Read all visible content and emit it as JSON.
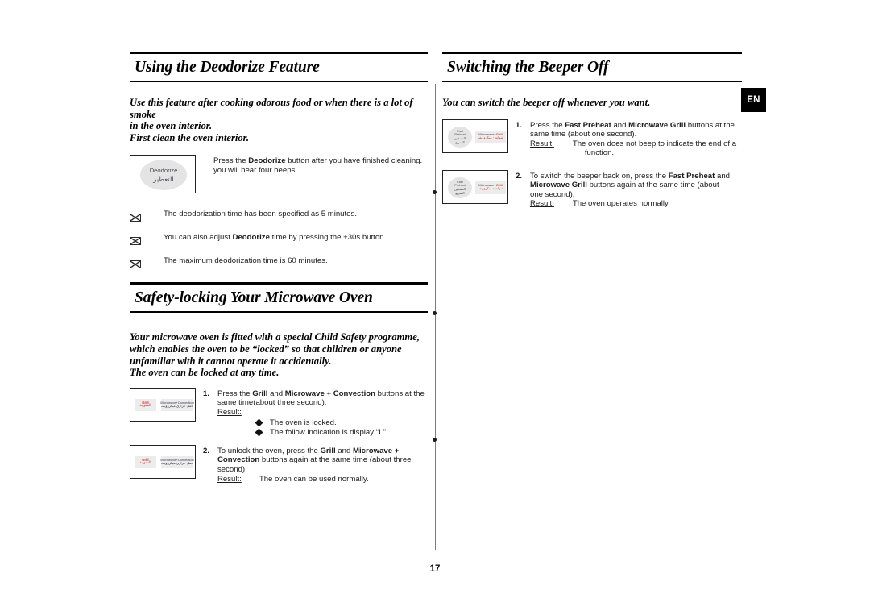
{
  "page": {
    "number": "17",
    "language_badge": "EN"
  },
  "left_column": {
    "section1": {
      "heading": "Using the Deodorize Feature",
      "intro_line1": "Use this feature after cooking odorous food or when there is a lot of smoke",
      "intro_line2": "in the oven interior.",
      "intro_line3": "First clean the oven interior.",
      "button_image": {
        "label_en": "Deodorize",
        "label_ar": "التعطير"
      },
      "instruction_line1_a": "Press the ",
      "instruction_line1_b": "Deodorize",
      "instruction_line1_c": " button after you have finished cleaning.",
      "instruction_line2": "you will hear four beeps.",
      "notes": [
        {
          "icon": "note-marker-icon",
          "text_a": "The deodorization time has been specified as 5 minutes.",
          "bold": "",
          "text_b": ""
        },
        {
          "icon": "note-marker-icon",
          "text_a": "You can also adjust ",
          "bold": "Deodorize",
          "text_b": " time by pressing the +30s button."
        },
        {
          "icon": "note-marker-icon",
          "text_a": "The maximum deodorization time is 60 minutes.",
          "bold": "",
          "text_b": ""
        }
      ]
    },
    "section2": {
      "heading": "Safety-locking Your Microwave Oven",
      "intro_line1": "Your microwave oven is fitted with a special Child Safety programme,",
      "intro_line2": "which enables the oven to be “locked” so that children or anyone",
      "intro_line3": "unfamiliar with it cannot operate it accidentally.",
      "intro_line4": "The oven can be locked at any time.",
      "button_image": {
        "chip1_en": "Grill",
        "chip1_ar": "الشواية",
        "chip2_en": "Microwave+Convection",
        "chip2_ar": "حمل حراري ميكروويف"
      },
      "steps": [
        {
          "number": "1.",
          "line1_a": "Press the ",
          "line1_bold1": "Grill",
          "line1_b": " and ",
          "line1_bold2": "Microwave + Convection",
          "line1_c": " buttons at the",
          "line2": "same time(about three second).",
          "result_label": "Result:",
          "result_inline": "",
          "bullets": [
            {
              "text_a": "The oven is locked.",
              "bold": "",
              "text_b": ""
            },
            {
              "text_a": "The follow indication is display “",
              "bold": "L",
              "text_b": "”."
            }
          ]
        },
        {
          "number": "2.",
          "line1_a": "To unlock the oven, press the ",
          "line1_bold1": "Grill",
          "line1_b": " and ",
          "line1_bold2": "Microwave +",
          "line1_c": "",
          "line2_bold": "Convection",
          "line2_a": " buttons again at the same time (about three",
          "line3": "second).",
          "result_label": "Result:",
          "result_inline": "The oven can be used normally.",
          "bullets": []
        }
      ]
    }
  },
  "right_column": {
    "section1": {
      "heading": "Switching the Beeper Off",
      "intro_line1": "You can switch the beeper off whenever you want.",
      "button_image": {
        "oval_en_line1": "Fast",
        "oval_en_line2": "Preheat",
        "oval_ar_line1": "التسخين",
        "oval_ar_line2": "السريع",
        "chip_en_a": "Microwave+",
        "chip_en_b": "Grill",
        "chip_ar": "شواية - ميكروويف"
      },
      "steps": [
        {
          "number": "1.",
          "line1_a": "Press the ",
          "line1_bold1": "Fast Preheat",
          "line1_b": " and ",
          "line1_bold2": "Microwave Grill",
          "line1_c": " buttons at the",
          "line2": "same time (about one second).",
          "result_label": "Result:",
          "result_line1": "The oven does not beep to indicate the end of a",
          "result_line2": "function."
        },
        {
          "number": "2.",
          "line1_a": "To switch the beeper back on, press the ",
          "line1_bold1": "Fast Preheat",
          "line1_b": " and",
          "line2_bold": "Microwave Grill",
          "line2_a": " buttons again at the same time (about",
          "line3": "one second).",
          "result_label": "Result:",
          "result_line1": "The oven operates normally.",
          "result_line2": ""
        }
      ]
    }
  }
}
